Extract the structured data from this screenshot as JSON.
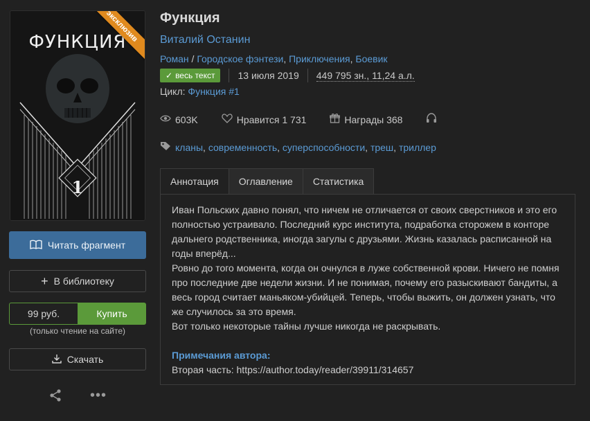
{
  "cover": {
    "title": "ФУНКЦИЯ",
    "number": "1",
    "badge": "эксклюзив"
  },
  "actions": {
    "read": "Читать фрагмент",
    "library": "В библиотеку",
    "price": "99 руб.",
    "buy": "Купить",
    "buy_note": "(только чтение на сайте)",
    "download": "Скачать"
  },
  "book": {
    "title": "Функция",
    "author": "Виталий Останин",
    "genres": [
      "Роман",
      "Городское фэнтези",
      "Приключения",
      "Боевик"
    ],
    "full_text_badge": "весь текст",
    "date": "13 июля 2019",
    "size": "449 795 зн., 11,24 а.л.",
    "cycle_label": "Цикл:",
    "cycle_name": "Функция #1"
  },
  "stats": {
    "views": "603K",
    "likes": "Нравится 1 731",
    "awards": "Награды 368"
  },
  "tags": [
    "кланы",
    "современность",
    "суперспособности",
    "треш",
    "триллер"
  ],
  "tabs": [
    "Аннотация",
    "Оглавление",
    "Статистика"
  ],
  "annotation": {
    "p1": "Иван Польских давно понял, что ничем не отличается от своих сверстников и это его полностью устраивало. Последний курс института, подработка сторожем в конторе дальнего родственника, иногда загулы с друзьями. Жизнь казалась расписанной на годы вперёд...",
    "p2": "Ровно до того момента, когда он очнулся в луже собственной крови. Ничего не помня про последние две недели жизни. И не понимая, почему его разыскивают бандиты, а весь город считает маньяком-убийцей. Теперь, чтобы выжить, он должен узнать, что же случилось за это время.",
    "p3": "Вот только некоторые тайны лучше никогда не раскрывать.",
    "notes_title": "Примечания автора:",
    "notes_text": "Вторая часть: https://author.today/reader/39911/314657"
  },
  "colors": {
    "accent_blue": "#5b9bd5",
    "green": "#5b9a3a",
    "button_blue": "#3c6c9a",
    "badge_orange": "#e08a1e"
  }
}
